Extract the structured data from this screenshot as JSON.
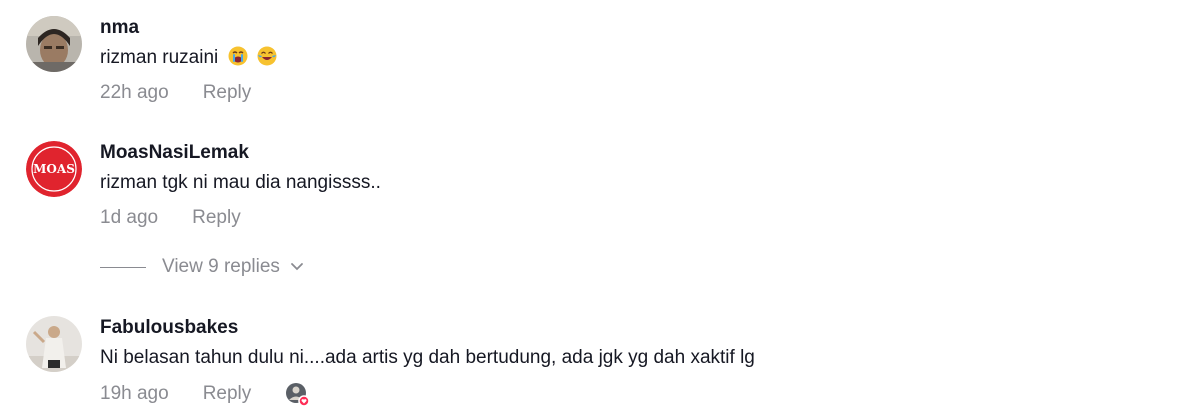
{
  "comments": [
    {
      "username": "nma",
      "text": "rizman ruzaini",
      "emoji": [
        "crying-face-emoji",
        "tears-of-joy-emoji"
      ],
      "time": "22h ago",
      "reply_label": "Reply"
    },
    {
      "username": "MoasNasiLemak",
      "avatar_text": "MOAS",
      "text": "rizman tgk ni mau dia nangissss..",
      "time": "1d ago",
      "reply_label": "Reply",
      "view_replies": "View 9 replies"
    },
    {
      "username": "Fabulousbakes",
      "text": "Ni belasan tahun dulu ni....ada artis yg dah bertudung, ada jgk yg dah xaktif lg",
      "time": "19h ago",
      "reply_label": "Reply"
    }
  ],
  "colors": {
    "text": "#161823",
    "muted": "#8a8b91",
    "moas_red": "#e0242e",
    "like_red": "#fe2c55"
  }
}
